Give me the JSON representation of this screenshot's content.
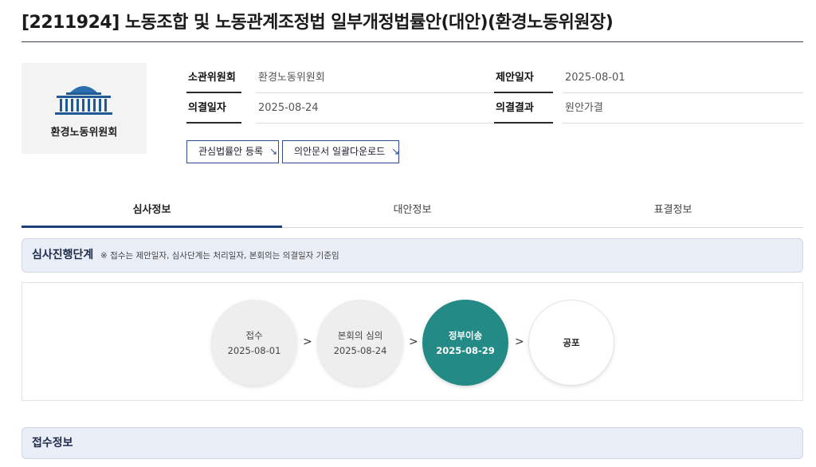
{
  "title": "[2211924] 노동조합 및 노동관계조정법 일부개정법률안(대안)(환경노동위원장)",
  "committee_logo": {
    "icon": "national-assembly-building-icon",
    "name": "환경노동위원회"
  },
  "info": {
    "committee_label": "소관위원회",
    "committee_value": "환경노동위원회",
    "proposal_date_label": "제안일자",
    "proposal_date_value": "2025-08-01",
    "resolution_date_label": "의결일자",
    "resolution_date_value": "2025-08-24",
    "resolution_result_label": "의결결과",
    "resolution_result_value": "원안가결"
  },
  "buttons": {
    "register_label": "관심법률안 등록",
    "download_label": "의안문서 일괄다운로드",
    "arrow_icon": "download-arrow-icon"
  },
  "tabs": [
    "심사정보",
    "대안정보",
    "표결정보"
  ],
  "active_tab": "심사정보",
  "progress_section": {
    "title": "심사진행단계",
    "note": "※ 접수는 제안일자, 심사단계는 처리일자, 본회의는 의결일자 기준임"
  },
  "steps": [
    {
      "name": "접수",
      "date": "2025-08-01",
      "state": "done"
    },
    {
      "name": "본회의 심의",
      "date": "2025-08-24",
      "state": "done"
    },
    {
      "name": "정부이송",
      "date": "2025-08-29",
      "state": "current"
    },
    {
      "name": "공포",
      "date": "",
      "state": "pending"
    }
  ],
  "receipt_section": {
    "title": "접수정보"
  },
  "colors": {
    "accent": "#238a86",
    "navy": "#1d3f7a",
    "section_bg": "#eaeef6"
  }
}
